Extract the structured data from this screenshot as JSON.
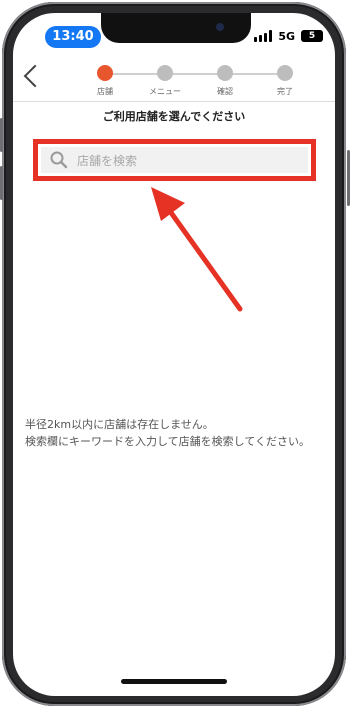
{
  "status_bar": {
    "time": "13:40",
    "carrier_icon": "5G-signal",
    "battery_level": "5"
  },
  "header": {
    "back_icon": "chevron-left-icon",
    "steps": [
      {
        "label": "店舗",
        "active": true
      },
      {
        "label": "メニュー",
        "active": false
      },
      {
        "label": "確認",
        "active": false
      },
      {
        "label": "完了",
        "active": false
      }
    ],
    "title": "ご利用店舗を選んでください"
  },
  "search": {
    "placeholder": "店舗を検索",
    "highlight_color": "#e53225"
  },
  "message": {
    "line1": "半径2km以内に店舗は存在しません。",
    "line2": "検索欄にキーワードを入力して店舗を検索してください。"
  },
  "colors": {
    "accent": "#e8562d",
    "time_pill": "#1478f4"
  }
}
